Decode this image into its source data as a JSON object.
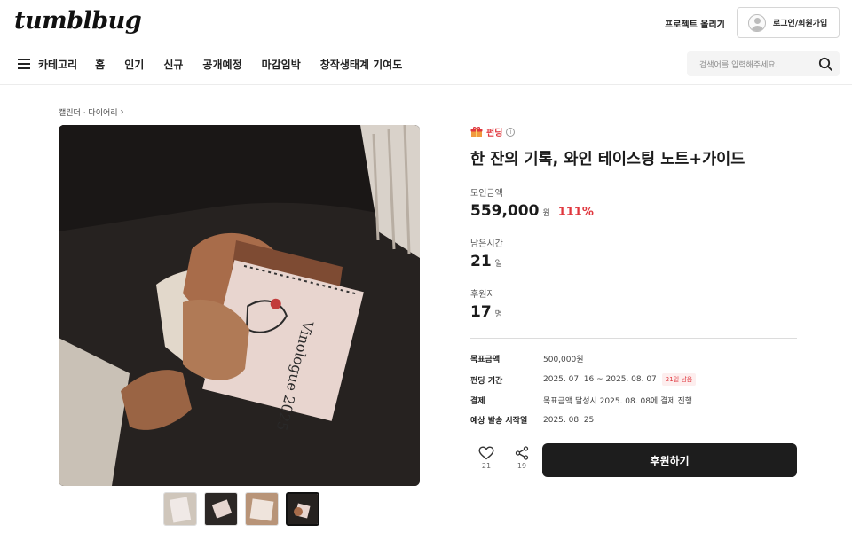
{
  "header": {
    "logo": "tumblbug",
    "project_link": "프로젝트 올리기",
    "login": "로그인/회원가입"
  },
  "nav": {
    "category": "카테고리",
    "items": [
      "홈",
      "인기",
      "신규",
      "공개예정",
      "마감임박",
      "창작생태계 기여도"
    ]
  },
  "search": {
    "placeholder": "검색어를 입력해주세요."
  },
  "breadcrumb": {
    "path": "캘린더 · 다이어리",
    "chevron": "›"
  },
  "project": {
    "badge": "펀딩",
    "title": "한 잔의 기록, 와인 테이스팅 노트+가이드",
    "raised_label": "모인금액",
    "raised_value": "559,000",
    "raised_unit": "원",
    "raised_percent": "111%",
    "time_label": "남은시간",
    "time_value": "21",
    "time_unit": "일",
    "backers_label": "후원자",
    "backers_value": "17",
    "backers_unit": "명"
  },
  "details": [
    {
      "key": "목표금액",
      "value": "500,000원"
    },
    {
      "key": "펀딩 기간",
      "value": "2025. 07. 16 ~ 2025. 08. 07",
      "chip": "21일 남음"
    },
    {
      "key": "결제",
      "value": "목표금액 달성시 2025. 08. 08에 결제 진행"
    },
    {
      "key": "예상 발송 시작일",
      "value": "2025. 08. 25"
    }
  ],
  "actions": {
    "likes": "21",
    "shares": "19",
    "support": "후원하기"
  },
  "colors": {
    "accent": "#e0373e",
    "button": "#1d1d1d"
  },
  "icons": [
    "menu-icon",
    "search-icon",
    "avatar-icon",
    "gift-icon",
    "info-icon",
    "heart-icon",
    "share-icon"
  ]
}
